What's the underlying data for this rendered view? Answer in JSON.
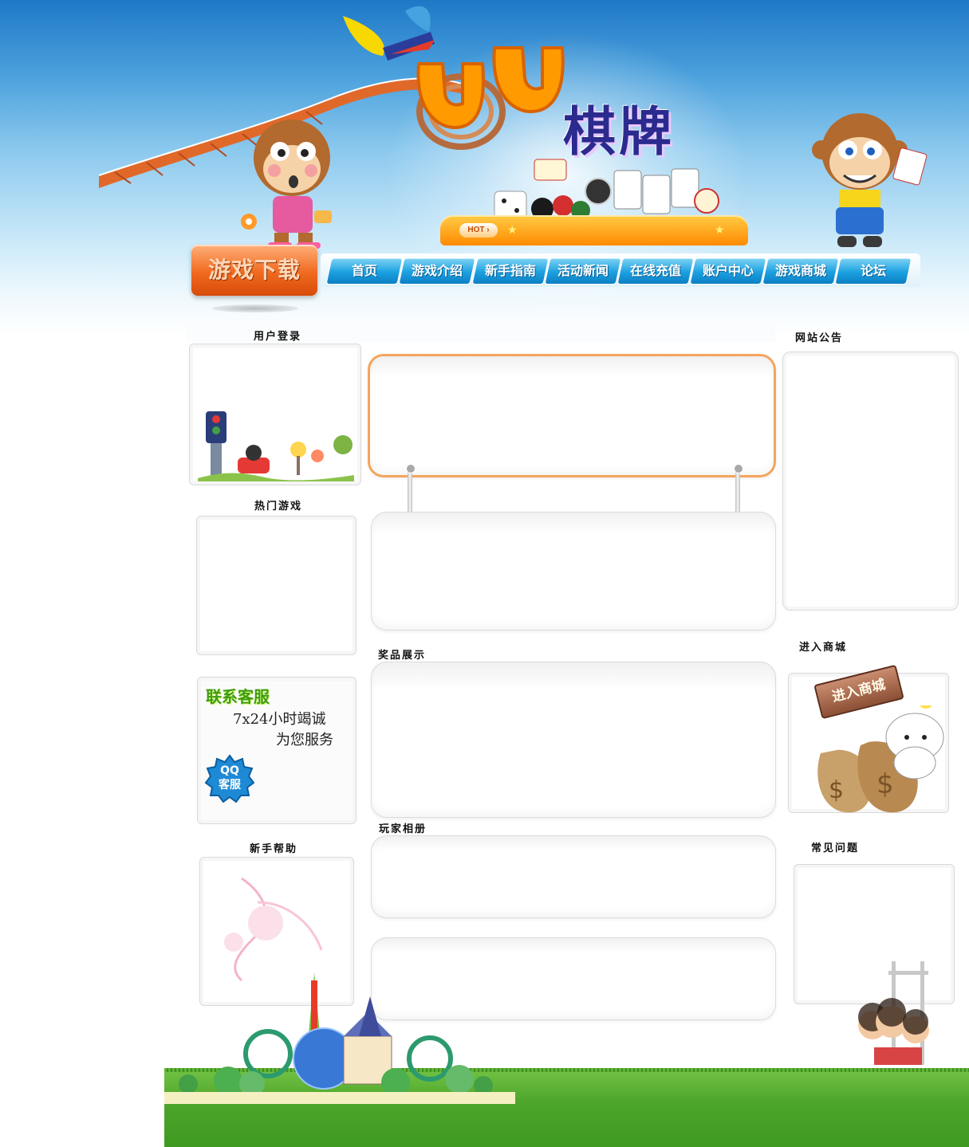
{
  "header": {
    "logo_letters": "UU",
    "logo_title": "棋牌",
    "hot_badge": "HOT ›",
    "download_button": "游戏下载"
  },
  "nav": {
    "items": [
      {
        "label": "首页"
      },
      {
        "label": "游戏介绍"
      },
      {
        "label": "新手指南"
      },
      {
        "label": "活动新闻"
      },
      {
        "label": "在线充值"
      },
      {
        "label": "账户中心"
      },
      {
        "label": "游戏商城"
      },
      {
        "label": "论坛"
      }
    ]
  },
  "left": {
    "login_title": "用户登录",
    "hot_games_title": "热门游戏",
    "kefu": {
      "title": "联系客服",
      "line1": "7x24小时竭诚",
      "line2": "为您服务",
      "qq_line1": "QQ",
      "qq_line2": "客服"
    },
    "help_title": "新手帮助"
  },
  "center": {
    "prizes_title": "奖品展示",
    "album_title": "玩家相册"
  },
  "right": {
    "notice_title": "网站公告",
    "shop_title": "进入商城",
    "shop_sign": "进入商城",
    "faq_title": "常见问题"
  },
  "colors": {
    "sky_top": "#1f78c6",
    "nav_blue": "#1ba0e0",
    "download_orange": "#f06a1f",
    "hot_bar": "#ff8a00",
    "panel_orange_border": "#f5a45c",
    "grass": "#4da52b"
  }
}
